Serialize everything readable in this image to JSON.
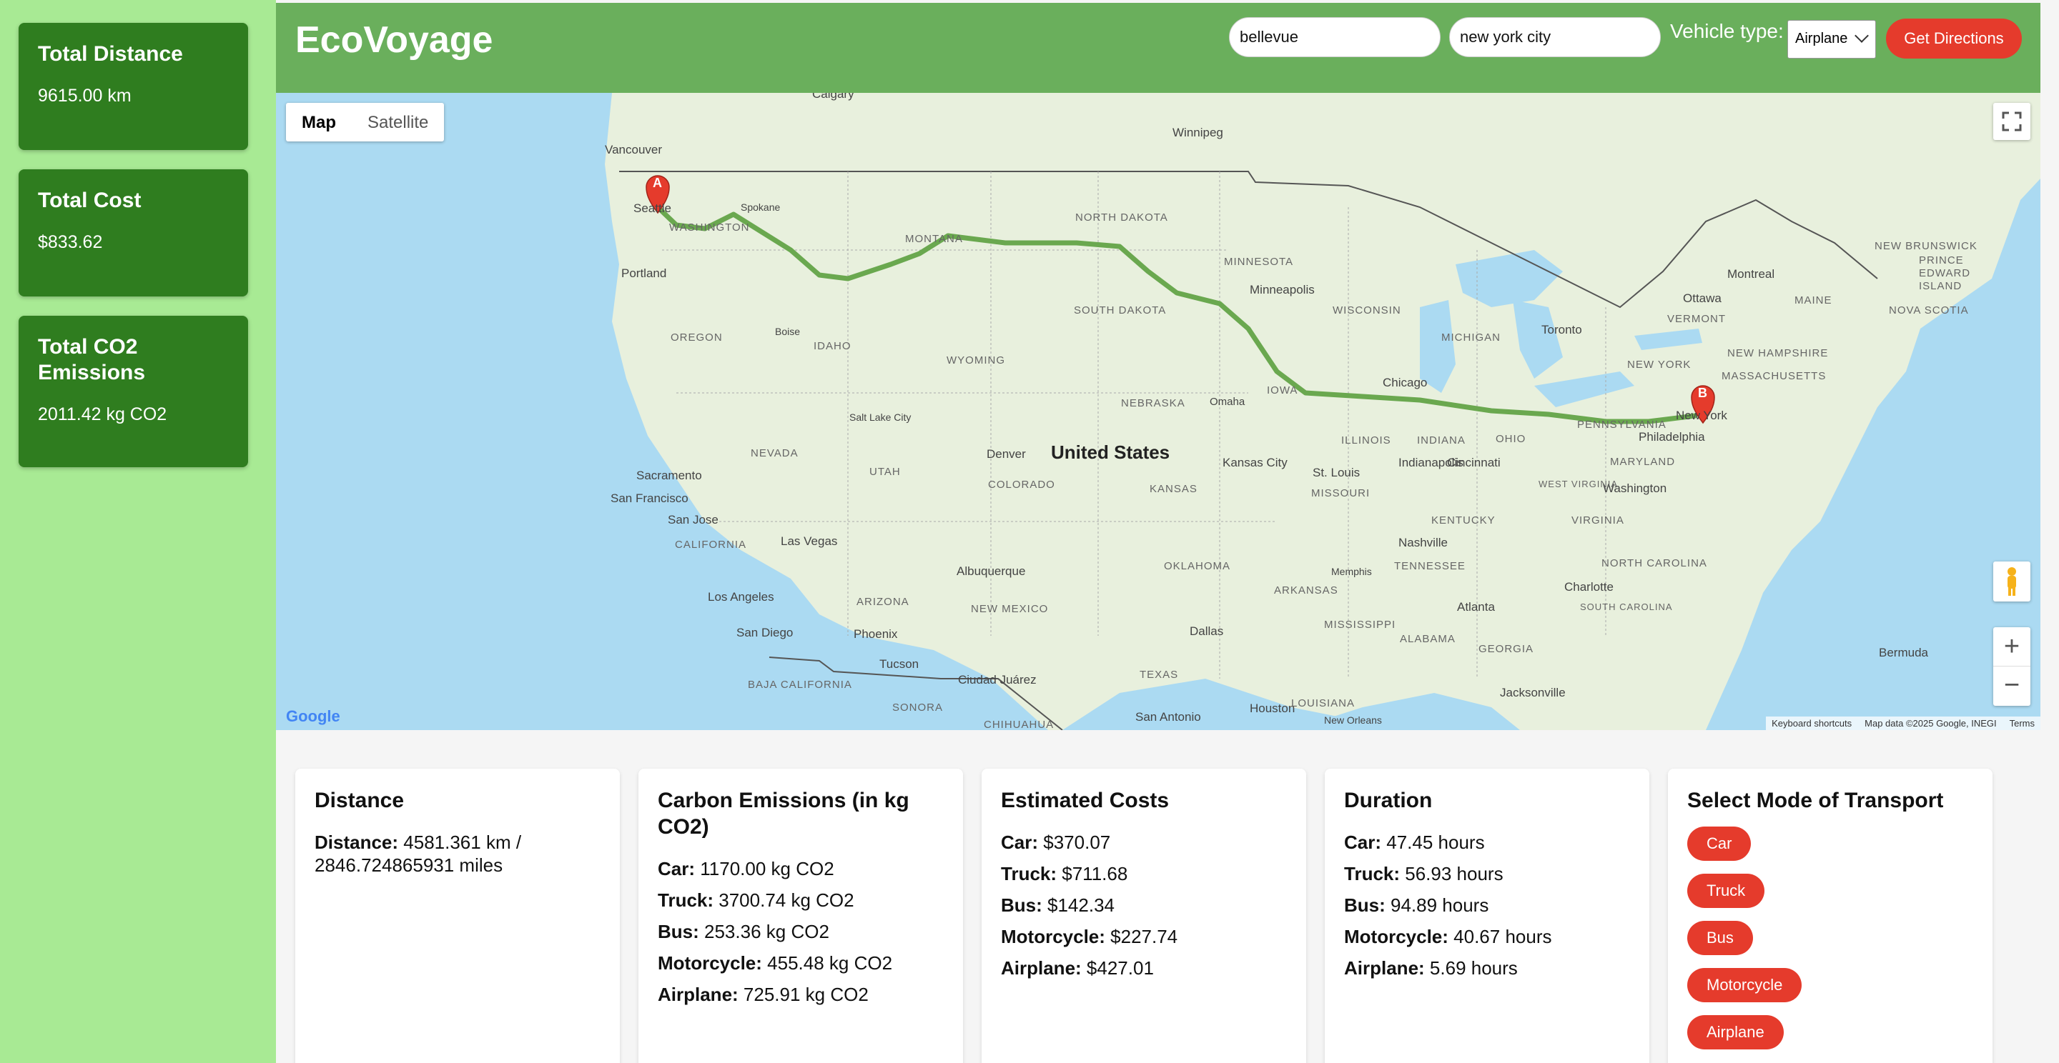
{
  "sidebar": {
    "cards": [
      {
        "title": "Total Distance",
        "value": "9615.00 km"
      },
      {
        "title": "Total Cost",
        "value": "$833.62"
      },
      {
        "title": "Total CO2 Emissions",
        "value": "2011.42 kg CO2"
      }
    ]
  },
  "header": {
    "brand": "EcoVoyage",
    "origin_value": "bellevue",
    "destination_value": "new york city",
    "vehicle_label": "Vehicle type:",
    "vehicle_selected": "Airplane",
    "directions_button": "Get Directions"
  },
  "map": {
    "maptype_options": [
      "Map",
      "Satellite"
    ],
    "active_maptype": "Map",
    "marker_a": "A",
    "marker_b": "B",
    "country_label": "United States",
    "city_labels": [
      "Calgary",
      "Vancouver",
      "Seattle",
      "Spokane",
      "Portland",
      "Winnipeg",
      "Minneapolis",
      "Chicago",
      "Toronto",
      "Ottawa",
      "Montreal",
      "New York",
      "Philadelphia",
      "Washington",
      "Sacramento",
      "San Francisco",
      "San Jose",
      "Las Vegas",
      "Los Angeles",
      "San Diego",
      "Phoenix",
      "Tucson",
      "Ciudad Juárez",
      "Albuquerque",
      "Denver",
      "Salt Lake City",
      "Boise",
      "Omaha",
      "Kansas City",
      "St. Louis",
      "Indianapolis",
      "Cincinnati",
      "Nashville",
      "Memphis",
      "Atlanta",
      "Charlotte",
      "Dallas",
      "Houston",
      "San Antonio",
      "New Orleans",
      "Jacksonville",
      "Bermuda"
    ],
    "state_labels": [
      "WASHINGTON",
      "MONTANA",
      "NORTH DAKOTA",
      "SOUTH DAKOTA",
      "MINNESOTA",
      "WISCONSIN",
      "MICHIGAN",
      "OREGON",
      "IDAHO",
      "WYOMING",
      "NEBRASKA",
      "IOWA",
      "ILLINOIS",
      "INDIANA",
      "OHIO",
      "PENNSYLVANIA",
      "NEW YORK",
      "VERMONT",
      "MAINE",
      "NEVADA",
      "UTAH",
      "COLORADO",
      "KANSAS",
      "MISSOURI",
      "CALIFORNIA",
      "ARIZONA",
      "NEW MEXICO",
      "OKLAHOMA",
      "ARKANSAS",
      "TENNESSEE",
      "KENTUCKY",
      "VIRGINIA",
      "WEST VIRGINIA",
      "NORTH CAROLINA",
      "SOUTH CAROLINA",
      "GEORGIA",
      "ALABAMA",
      "MISSISSIPPI",
      "LOUISIANA",
      "TEXAS",
      "MARYLAND",
      "NEW HAMPSHIRE",
      "MASSACHUSETTS",
      "NEW BRUNSWICK",
      "NOVA SCOTIA",
      "PRINCE EDWARD ISLAND",
      "BAJA CALIFORNIA",
      "SONORA",
      "CHIHUAHUA"
    ],
    "attribution": [
      "Keyboard shortcuts",
      "Map data ©2025 Google, INEGI",
      "Terms"
    ],
    "logo": "Google",
    "zoom_in": "+",
    "zoom_out": "−"
  },
  "panels": {
    "distance": {
      "title": "Distance",
      "label": "Distance:",
      "value": "4581.361 km / 2846.724865931 miles"
    },
    "emissions": {
      "title": "Carbon Emissions (in kg CO2)",
      "rows": [
        {
          "label": "Car:",
          "value": "1170.00 kg CO2"
        },
        {
          "label": "Truck:",
          "value": "3700.74 kg CO2"
        },
        {
          "label": "Bus:",
          "value": "253.36 kg CO2"
        },
        {
          "label": "Motorcycle:",
          "value": "455.48 kg CO2"
        },
        {
          "label": "Airplane:",
          "value": "725.91 kg CO2"
        }
      ]
    },
    "costs": {
      "title": "Estimated Costs",
      "rows": [
        {
          "label": "Car:",
          "value": "$370.07"
        },
        {
          "label": "Truck:",
          "value": "$711.68"
        },
        {
          "label": "Bus:",
          "value": "$142.34"
        },
        {
          "label": "Motorcycle:",
          "value": "$227.74"
        },
        {
          "label": "Airplane:",
          "value": "$427.01"
        }
      ]
    },
    "duration": {
      "title": "Duration",
      "rows": [
        {
          "label": "Car:",
          "value": "47.45 hours"
        },
        {
          "label": "Truck:",
          "value": "56.93 hours"
        },
        {
          "label": "Bus:",
          "value": "94.89 hours"
        },
        {
          "label": "Motorcycle:",
          "value": "40.67 hours"
        },
        {
          "label": "Airplane:",
          "value": "5.69 hours"
        }
      ]
    },
    "modes": {
      "title": "Select Mode of Transport",
      "buttons": [
        "Car",
        "Truck",
        "Bus",
        "Motorcycle",
        "Airplane"
      ]
    }
  },
  "colors": {
    "sidebar_bg": "#a8ea94",
    "card_bg": "#2f7d1f",
    "header_bg": "#6aaf5c",
    "accent_red": "#e53b2c",
    "route_green": "#6aa84f"
  }
}
